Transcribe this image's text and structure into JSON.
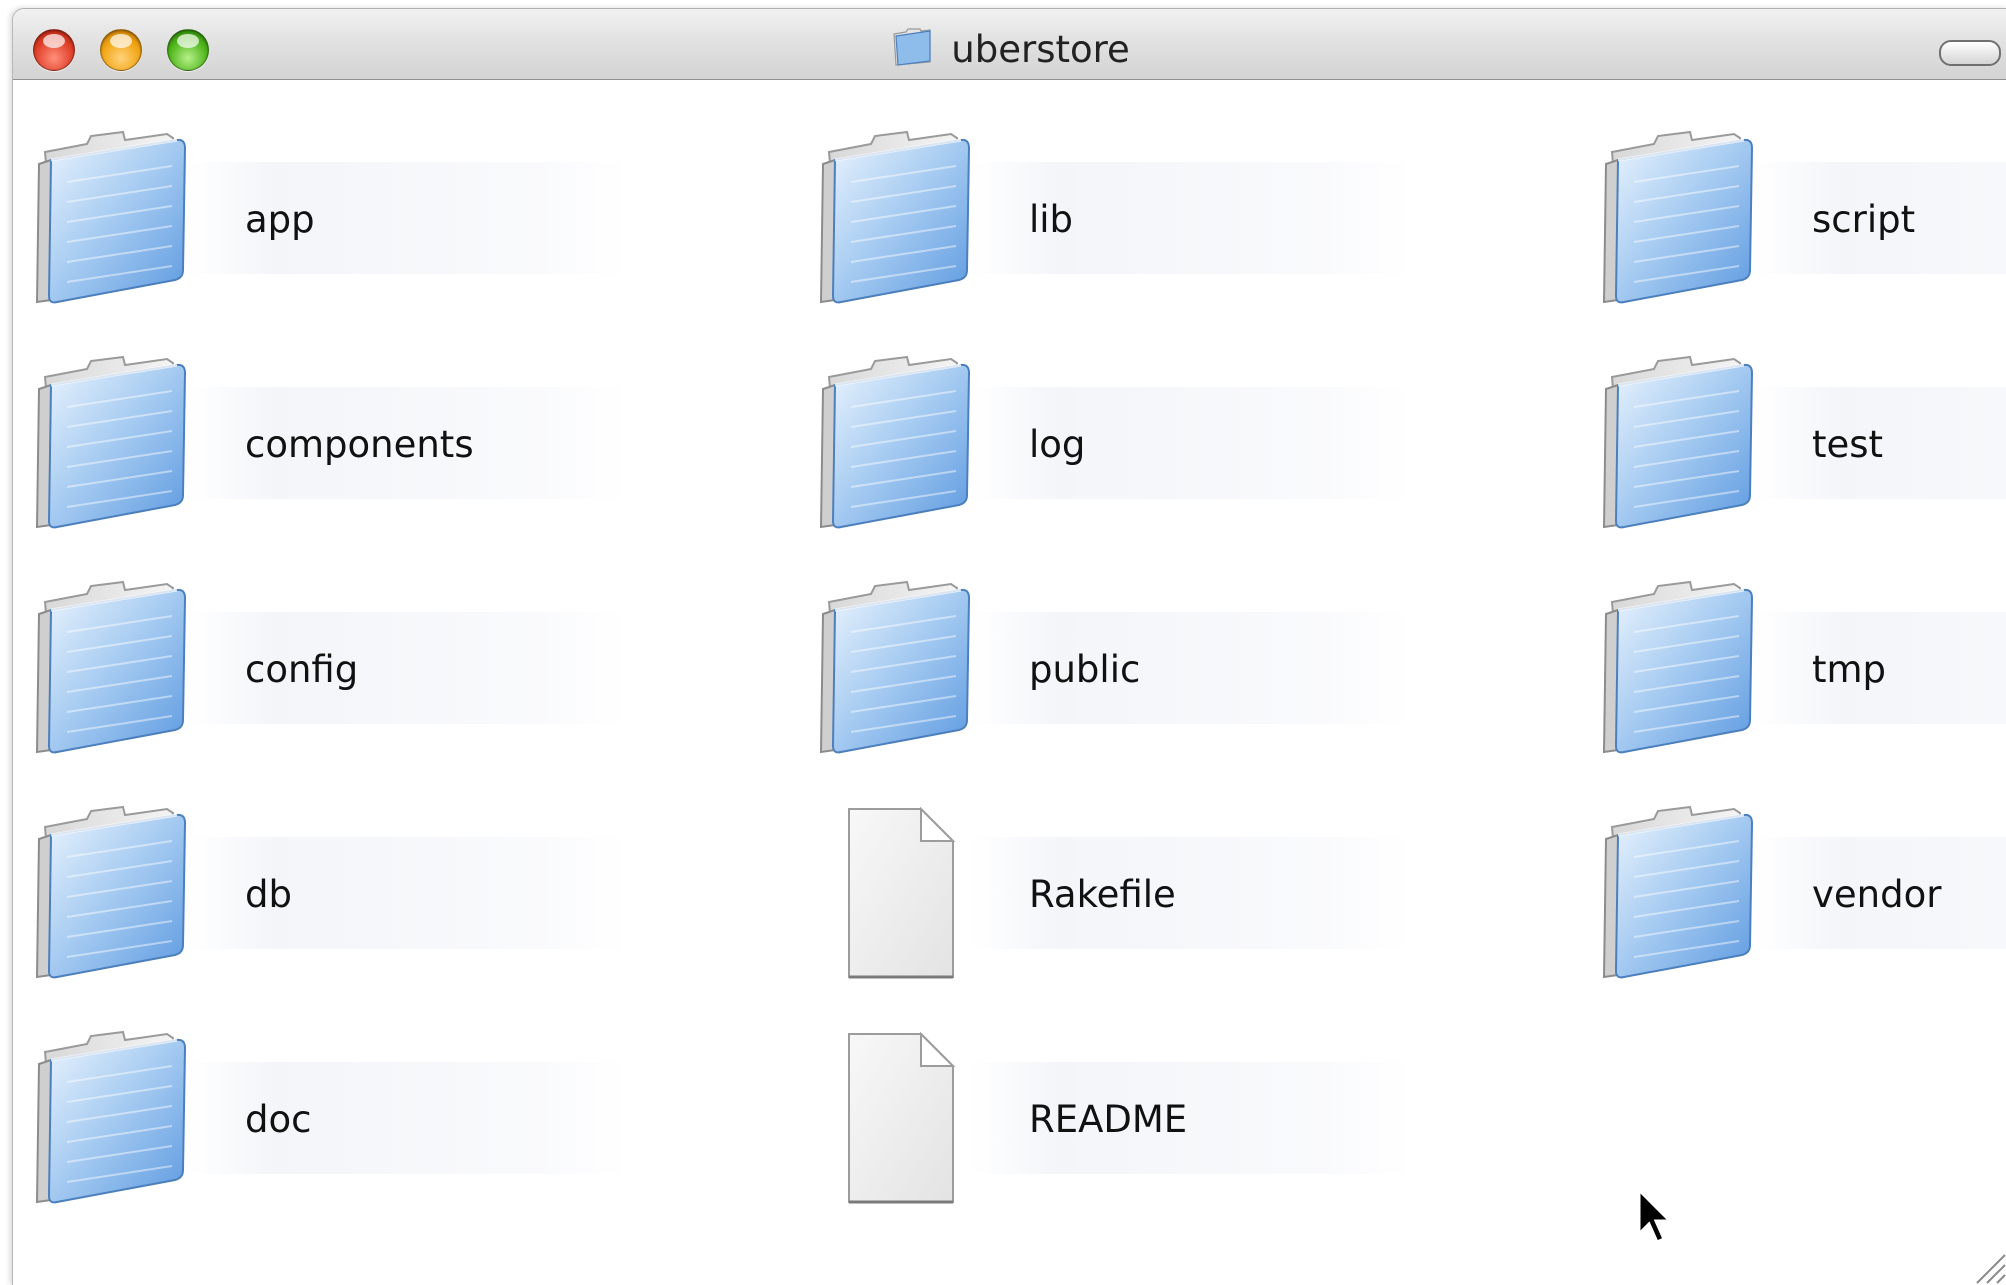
{
  "window": {
    "title": "uberstore",
    "title_icon": "folder-icon"
  },
  "traffic_lights": {
    "close": "#e0402a",
    "minimize": "#f2a514",
    "zoom": "#4fb61a"
  },
  "items": [
    {
      "label": "app",
      "kind": "folder"
    },
    {
      "label": "components",
      "kind": "folder"
    },
    {
      "label": "config",
      "kind": "folder"
    },
    {
      "label": "db",
      "kind": "folder"
    },
    {
      "label": "doc",
      "kind": "folder"
    },
    {
      "label": "lib",
      "kind": "folder"
    },
    {
      "label": "log",
      "kind": "folder"
    },
    {
      "label": "public",
      "kind": "folder"
    },
    {
      "label": "Rakefile",
      "kind": "document"
    },
    {
      "label": "README",
      "kind": "document"
    },
    {
      "label": "script",
      "kind": "folder"
    },
    {
      "label": "test",
      "kind": "folder"
    },
    {
      "label": "tmp",
      "kind": "folder"
    },
    {
      "label": "vendor",
      "kind": "folder"
    }
  ],
  "colors": {
    "folder_blue": "#7fb2e6",
    "titlebar": "#dadada"
  }
}
